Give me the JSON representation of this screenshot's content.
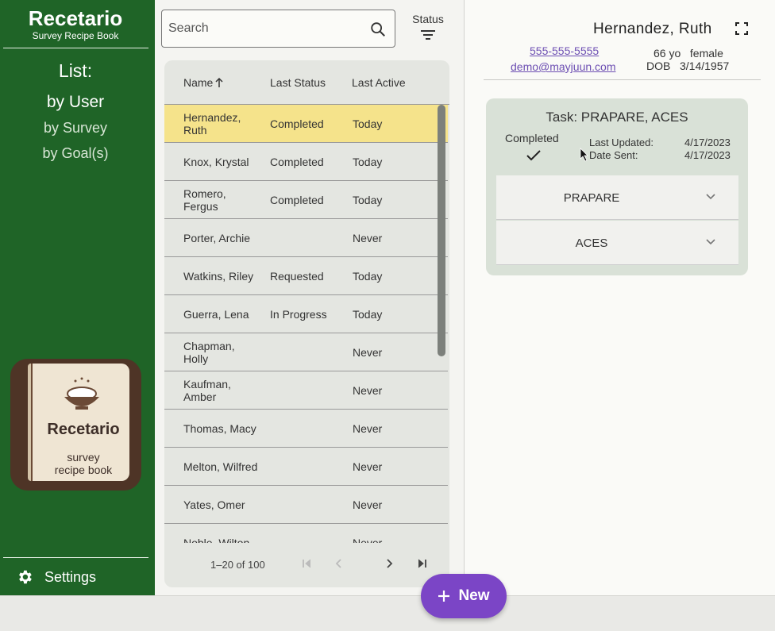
{
  "brand": {
    "title": "Recetario",
    "subtitle": "Survey Recipe Book"
  },
  "sidebar": {
    "list_heading": "List:",
    "nav": [
      {
        "label": "by User",
        "active": true
      },
      {
        "label": "by Survey",
        "active": false
      },
      {
        "label": "by Goal(s)",
        "active": false
      }
    ],
    "logo": {
      "title": "Recetario",
      "sub1": "survey",
      "sub2": "recipe book"
    },
    "settings_label": "Settings"
  },
  "search": {
    "placeholder": "Search"
  },
  "status_filter": {
    "label": "Status"
  },
  "table": {
    "headers": {
      "name": "Name",
      "last_status": "Last Status",
      "last_active": "Last Active"
    },
    "rows": [
      {
        "name": "Hernandez, Ruth",
        "status": "Completed",
        "active": "Today",
        "selected": true
      },
      {
        "name": "Knox, Krystal",
        "status": "Completed",
        "active": "Today"
      },
      {
        "name": "Romero, Fergus",
        "status": "Completed",
        "active": "Today"
      },
      {
        "name": "Porter, Archie",
        "status": "",
        "active": "Never"
      },
      {
        "name": "Watkins, Riley",
        "status": "Requested",
        "active": "Today"
      },
      {
        "name": "Guerra, Lena",
        "status": "In Progress",
        "active": "Today"
      },
      {
        "name": "Chapman, Holly",
        "status": "",
        "active": "Never"
      },
      {
        "name": "Kaufman, Amber",
        "status": "",
        "active": "Never"
      },
      {
        "name": "Thomas, Macy",
        "status": "",
        "active": "Never"
      },
      {
        "name": "Melton, Wilfred",
        "status": "",
        "active": "Never"
      },
      {
        "name": "Yates, Omer",
        "status": "",
        "active": "Never"
      },
      {
        "name": "Noble, Wilton",
        "status": "",
        "active": "Never"
      }
    ],
    "pagination": "1–20 of 100"
  },
  "patient": {
    "name": "Hernandez, Ruth",
    "phone": "555-555-5555",
    "email": "demo@mayjuun.com",
    "age_sex": "66 yo   female",
    "dob": "DOB   3/14/1957"
  },
  "task": {
    "title": "Task: PRAPARE, ACES",
    "status": "Completed",
    "last_updated_label": "Last Updated:",
    "last_updated": "4/17/2023",
    "date_sent_label": "Date Sent:",
    "date_sent": "4/17/2023",
    "surveys": [
      "PRAPARE",
      "ACES"
    ]
  },
  "fab": {
    "label": "New"
  },
  "colors": {
    "sidebar": "#1f6427",
    "selected_row": "#f5e38b",
    "accent": "#7b45c6"
  }
}
